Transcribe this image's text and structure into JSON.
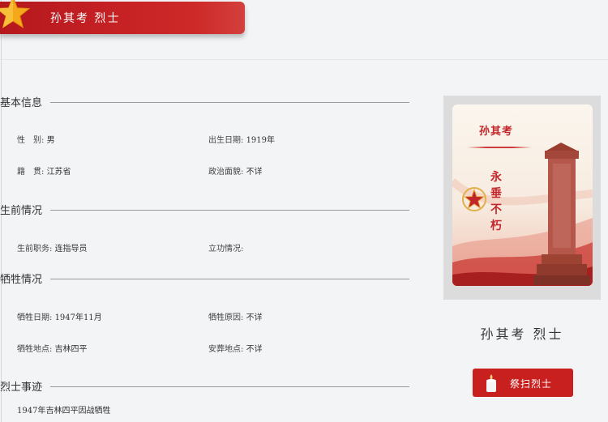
{
  "header": {
    "title": "孙其考 烈士"
  },
  "sections": {
    "basic": {
      "title": "基本信息",
      "gender_label": "性　别:",
      "gender": "男",
      "birth_label": "出生日期:",
      "birth": "1919年",
      "native_label": "籍　贯:",
      "native": "江苏省",
      "political_label": "政治面貌:",
      "political": "不详"
    },
    "life": {
      "title": "生前情况",
      "position_label": "生前职务:",
      "position": "连指导员",
      "merit_label": "立功情况:",
      "merit": ""
    },
    "sacrifice": {
      "title": "牺牲情况",
      "date_label": "牺牲日期:",
      "date": "1947年11月",
      "reason_label": "牺牲原因:",
      "reason": "不详",
      "place_label": "牺牲地点:",
      "place": "吉林四平",
      "burial_label": "安葬地点:",
      "burial": "不详"
    },
    "deeds": {
      "title": "烈士事迹",
      "text": "1947年吉林四平因战牺牲"
    }
  },
  "portrait": {
    "name": "孙其考",
    "slogan": "永垂不朽"
  },
  "profile": {
    "name": "孙其考 烈士"
  },
  "tribute_button": {
    "label": "祭扫烈士"
  },
  "colors": {
    "brand_red": "#c8201f",
    "gold": "#f2a712",
    "background": "#f3f4f6"
  }
}
